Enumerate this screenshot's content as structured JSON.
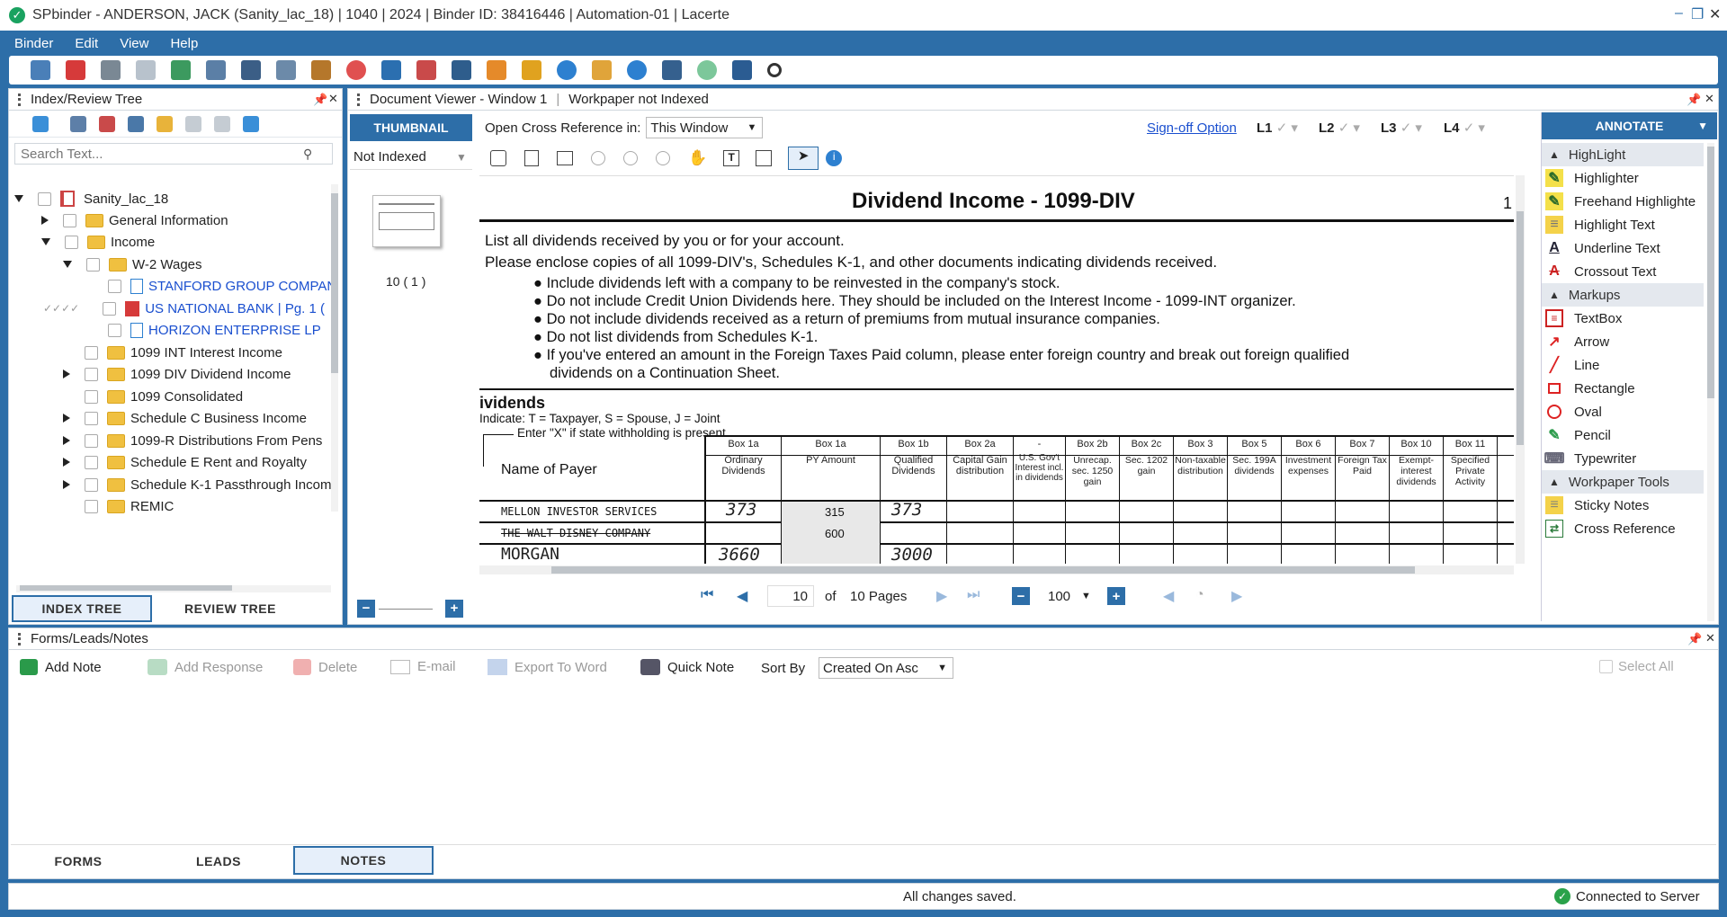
{
  "window": {
    "title": "SPbinder - ANDERSON, JACK (Sanity_lac_18) | 1040 | 2024 | Binder ID: 38416446 | Automation-01 | Lacerte"
  },
  "menu": [
    "Binder",
    "Edit",
    "View",
    "Help"
  ],
  "colors": {
    "brand": "#2d6ea8",
    "link": "#1a4fcf",
    "accent_tab": "#2d6ea8"
  },
  "index_panel": {
    "title": "Index/Review Tree",
    "search_placeholder": "Search Text...",
    "tree": [
      {
        "label": "Sanity_lac_18"
      },
      {
        "label": "General Information"
      },
      {
        "label": "Income"
      },
      {
        "label": "W-2 Wages"
      },
      {
        "label": "STANFORD GROUP COMPAN"
      },
      {
        "label": "US NATIONAL BANK  | Pg. 1 ("
      },
      {
        "label": "HORIZON ENTERPRISE LP"
      },
      {
        "label": "1099 INT Interest Income"
      },
      {
        "label": "1099 DIV Dividend Income"
      },
      {
        "label": "1099 Consolidated"
      },
      {
        "label": "Schedule C Business Income"
      },
      {
        "label": "1099-R  Distributions From Pens"
      },
      {
        "label": "Schedule E  Rent and Royalty"
      },
      {
        "label": "Schedule K-1 Passthrough Incom"
      },
      {
        "label": "REMIC"
      }
    ],
    "tabs": [
      "INDEX TREE",
      "REVIEW TREE"
    ]
  },
  "viewer": {
    "title": "Document Viewer - Window 1",
    "status": "Workpaper not Indexed",
    "thumbnail_tab": "THUMBNAIL",
    "filter_label": "Not Indexed",
    "thumb_caption": "10 ( 1 )",
    "open_xref_label": "Open Cross Reference in:",
    "open_xref_value": "This Window",
    "signoff_label": "Sign-off Option",
    "levels": [
      "L1",
      "L2",
      "L3",
      "L4"
    ],
    "page_current": "10",
    "page_of": "of",
    "page_total": "10 Pages",
    "zoom": "100"
  },
  "document": {
    "heading": "Dividend Income - 1099-DIV",
    "page_corner": "1",
    "line1": "List all dividends received by you or for your account.",
    "line2": "Please enclose copies of all 1099-DIV's, Schedules K-1, and other documents indicating dividends received.",
    "bullets": [
      "Include dividends left with a company to be reinvested in the company's stock.",
      "Do not include Credit Union Dividends here. They should be included on the Interest Income - 1099-INT organizer.",
      "Do not include dividends received as a return of premiums from mutual insurance companies.",
      "Do not list dividends from Schedules K-1.",
      "If you've entered an amount in the Foreign Taxes Paid column, please enter foreign country and break out foreign qualified",
      "dividends on a Continuation Sheet."
    ],
    "section": "ividends",
    "indicate": "Indicate: T = Taxpayer, S = Spouse, J = Joint",
    "enter_x": "Enter \"X\" if state withholding is present",
    "payer_header": "Name of Payer",
    "box_headers": [
      "Box 1a",
      "Box 1a",
      "Box 1b",
      "Box 2a",
      "-",
      "Box 2b",
      "Box 2c",
      "Box 3",
      "Box 5",
      "Box 6",
      "Box 7",
      "Box 10",
      "Box 11"
    ],
    "col_headers": [
      "Ordinary Dividends",
      "PY Amount",
      "Qualified Dividends",
      "Capital Gain distribution",
      "U.S. Gov't Interest incl. in dividends",
      "Unrecap. sec. 1250 gain",
      "Sec. 1202 gain",
      "Non-taxable distribution",
      "Sec. 199A dividends",
      "Investment expenses",
      "Foreign Tax Paid",
      "Exempt-interest dividends",
      "Specified Private Activity"
    ],
    "rows": [
      {
        "payer": "MELLON INVESTOR SERVICES",
        "ordinary": "373",
        "py": "315",
        "qualified": "373"
      },
      {
        "payer": "THE WALT DISNEY COMPANY",
        "ordinary": "",
        "py": "600",
        "qualified": ""
      },
      {
        "payer": "MORGAN",
        "ordinary": "3660",
        "py": "",
        "qualified": "3000"
      }
    ]
  },
  "annotate": {
    "title": "ANNOTATE",
    "sections": [
      {
        "name": "HighLight",
        "items": [
          "Highlighter",
          "Freehand Highlighte",
          "Highlight Text",
          "Underline Text",
          "Crossout Text"
        ]
      },
      {
        "name": "Markups",
        "items": [
          "TextBox",
          "Arrow",
          "Line",
          "Rectangle",
          "Oval",
          "Pencil",
          "Typewriter"
        ]
      },
      {
        "name": "Workpaper Tools",
        "items": [
          "Sticky Notes",
          "Cross Reference"
        ]
      }
    ]
  },
  "notes_panel": {
    "title": "Forms/Leads/Notes",
    "buttons": [
      "Add Note",
      "Add Response",
      "Delete",
      "E-mail",
      "Export To Word",
      "Quick Note"
    ],
    "sort_label": "Sort By",
    "sort_value": "Created On Asc",
    "select_all": "Select All",
    "tabs": [
      "FORMS",
      "LEADS",
      "NOTES"
    ]
  },
  "statusbar": {
    "message": "All changes saved.",
    "connection": "Connected to Server"
  }
}
